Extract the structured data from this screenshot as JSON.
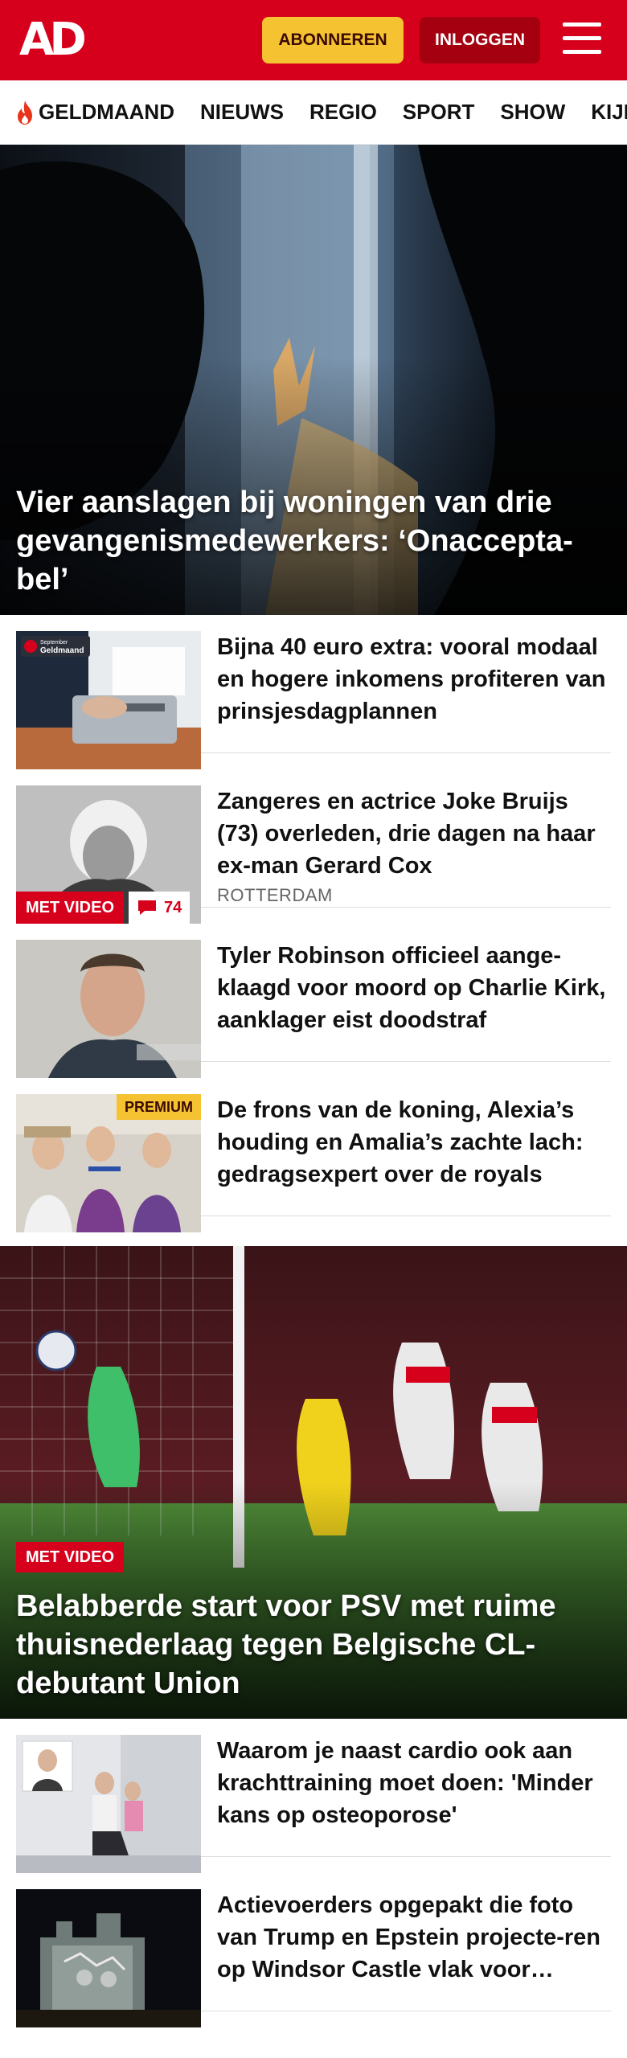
{
  "header": {
    "logo": "AD",
    "subscribe_label": "ABONNEREN",
    "login_label": "INLOGGEN",
    "menu_icon": "hamburger-menu-icon",
    "brand_color": "#d6001c",
    "accent_color": "#f5c232"
  },
  "nav": {
    "items": [
      "GELDMAAND",
      "NIEUWS",
      "REGIO",
      "SPORT",
      "SHOW",
      "KIJK"
    ]
  },
  "hero": {
    "title": "Vier aanslagen bij woningen van drie gevangenismedewerkers: ‘Onaccepta-bel’"
  },
  "articles": [
    {
      "title": "Bijna 40 euro extra: vooral modaal en hogere inkomens profiteren van prinsjesdagplannen",
      "thumb_label": "Geldmaand",
      "thumb_label_small": "September"
    },
    {
      "title": "Zangeres en actrice Joke Bruijs (73) overleden, drie dagen na haar ex-man Gerard Cox",
      "meta": "ROTTERDAM",
      "video_badge": "MET VIDEO",
      "comments": "74"
    },
    {
      "title": "Tyler Robinson officieel aange-klaagd voor moord op Charlie Kirk, aanklager eist doodstraf"
    },
    {
      "title": "De frons van de koning, Alexia’s houding en Amalia’s zachte lach: gedragsexpert over de royals",
      "premium_badge": "PREMIUM"
    }
  ],
  "sport_hero": {
    "video_badge": "MET VIDEO",
    "title": "Belabberde start voor PSV met ruime thuisnederlaag tegen Belgische CL-debutant Union"
  },
  "more_articles": [
    {
      "title": "Waarom je naast cardio ook aan krachttraining moet doen: 'Minder kans op osteoporose'"
    },
    {
      "title": "Actievoerders opgepakt die foto van Trump en Epstein projecte-ren op Windsor Castle vlak voor bezoek"
    }
  ]
}
